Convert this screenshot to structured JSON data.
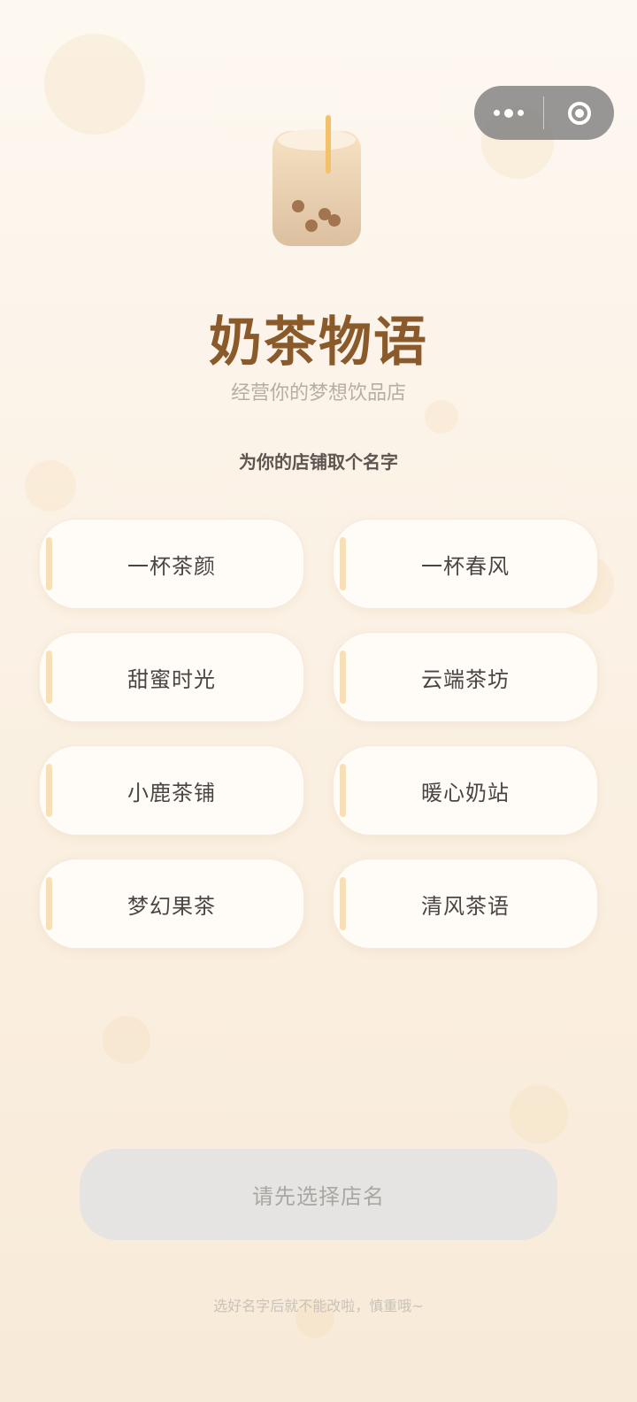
{
  "app": {
    "title": "奶茶物语",
    "subtitle": "经营你的梦想饮品店"
  },
  "capsule": {
    "more_icon": "more-dots-icon",
    "close_icon": "target-circle-icon"
  },
  "hero": {
    "icon": "bubble-tea-cup-icon"
  },
  "name_section": {
    "heading": "为你的店铺取个名字",
    "options": [
      {
        "label": "一杯茶颜"
      },
      {
        "label": "一杯春风"
      },
      {
        "label": "甜蜜时光"
      },
      {
        "label": "云端茶坊"
      },
      {
        "label": "小鹿茶铺"
      },
      {
        "label": "暖心奶站"
      },
      {
        "label": "梦幻果茶"
      },
      {
        "label": "清风茶语"
      }
    ]
  },
  "confirm_button": {
    "label": "请先选择店名"
  },
  "footer": {
    "hint": "选好名字后就不能改啦，慎重哦~"
  },
  "colors": {
    "title": "#8b5a2b",
    "accent_bar": "#f7dfb8",
    "card_bg": "#fffcf8",
    "button_disabled": "#e6e4e2"
  }
}
